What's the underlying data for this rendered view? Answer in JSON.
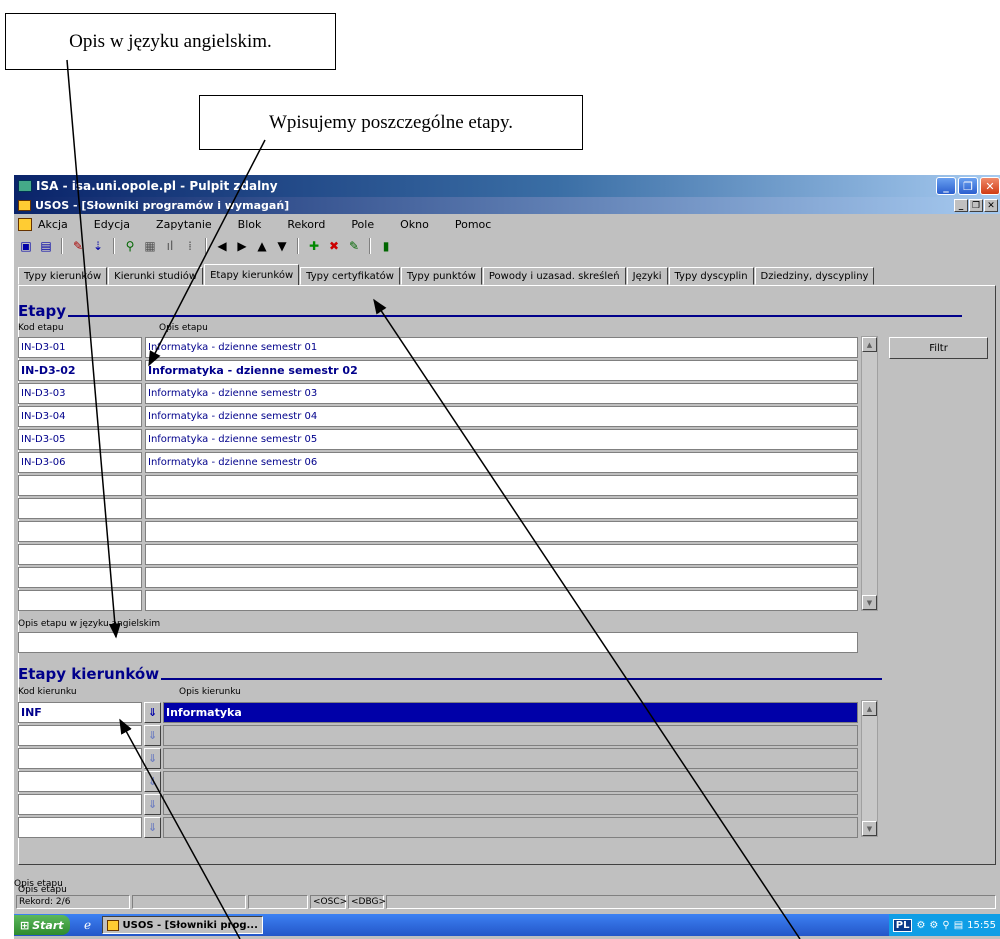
{
  "callouts": {
    "english_desc": "Opis w języku angielskim.",
    "stages": "Wpisujemy poszczególne etapy."
  },
  "remote_title": "ISA - isa.uni.opole.pl - Pulpit zdalny",
  "app_title": "USOS - [Słowniki programów i wymagań]",
  "menu": [
    "Akcja",
    "Edycja",
    "Zapytanie",
    "Blok",
    "Rekord",
    "Pole",
    "Okno",
    "Pomoc"
  ],
  "tabs": [
    "Typy kierunków",
    "Kierunki studiów",
    "Etapy kierunków",
    "Typy certyfikatów",
    "Typy punktów",
    "Powody i uzasad. skreśleń",
    "Języki",
    "Typy dyscyplin",
    "Dziedziny, dyscypliny"
  ],
  "active_tab": "Etapy kierunków",
  "etapy": {
    "title": "Etapy",
    "col_code": "Kod etapu",
    "col_desc": "Opis etapu",
    "rows": [
      {
        "code": "IN-D3-01",
        "desc": "Informatyka - dzienne semestr 01"
      },
      {
        "code": "IN-D3-02",
        "desc": "Informatyka - dzienne semestr 02"
      },
      {
        "code": "IN-D3-03",
        "desc": "Informatyka - dzienne semestr 03"
      },
      {
        "code": "IN-D3-04",
        "desc": "Informatyka - dzienne semestr 04"
      },
      {
        "code": "IN-D3-05",
        "desc": "Informatyka - dzienne semestr 05"
      },
      {
        "code": "IN-D3-06",
        "desc": "Informatyka - dzienne semestr 06"
      },
      {
        "code": "",
        "desc": ""
      },
      {
        "code": "",
        "desc": ""
      },
      {
        "code": "",
        "desc": ""
      },
      {
        "code": "",
        "desc": ""
      },
      {
        "code": "",
        "desc": ""
      },
      {
        "code": "",
        "desc": ""
      }
    ],
    "english_label": "Opis etapu w języku angielskim",
    "english_value": ""
  },
  "filter_button": "Filtr",
  "kierunki": {
    "title": "Etapy kierunków",
    "col_code": "Kod kierunku",
    "col_desc": "Opis kierunku",
    "rows": [
      {
        "code": "INF",
        "desc": "Informatyka"
      },
      {
        "code": "",
        "desc": ""
      },
      {
        "code": "",
        "desc": ""
      },
      {
        "code": "",
        "desc": ""
      },
      {
        "code": "",
        "desc": ""
      },
      {
        "code": "",
        "desc": ""
      }
    ]
  },
  "status": {
    "field": "Opis etapu",
    "record": "Rekord: 2/6",
    "osc": "<OSC>",
    "dbg": "<DBG>"
  },
  "taskbar": {
    "start": "Start",
    "task": "USOS - [Słowniki prog...",
    "lang": "PL",
    "clock": "15:55"
  }
}
